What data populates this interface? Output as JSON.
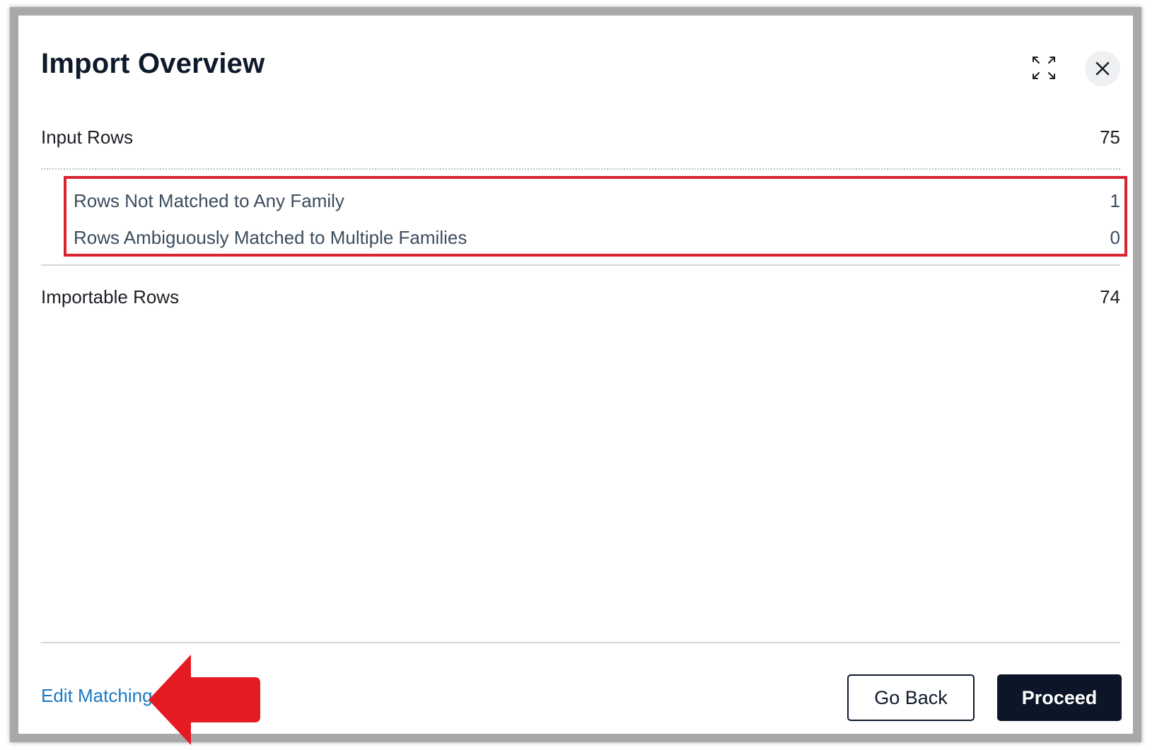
{
  "dialog": {
    "title": "Import Overview"
  },
  "icons": {
    "expand": "expand-icon",
    "close": "close-icon",
    "arrow": "red-arrow-left"
  },
  "rows": {
    "input": {
      "label": "Input Rows",
      "value": "75"
    },
    "not_matched": {
      "label": "Rows Not Matched to Any Family",
      "value": "1"
    },
    "ambiguous": {
      "label": "Rows Ambiguously Matched to Multiple Families",
      "value": "0"
    },
    "importable": {
      "label": "Importable Rows",
      "value": "74"
    }
  },
  "footer": {
    "edit_link": "Edit Matching",
    "go_back": "Go Back",
    "proceed": "Proceed"
  },
  "colors": {
    "highlight": "#d9232e",
    "link": "#1a7ac4",
    "primary_button": "#0c1628"
  }
}
